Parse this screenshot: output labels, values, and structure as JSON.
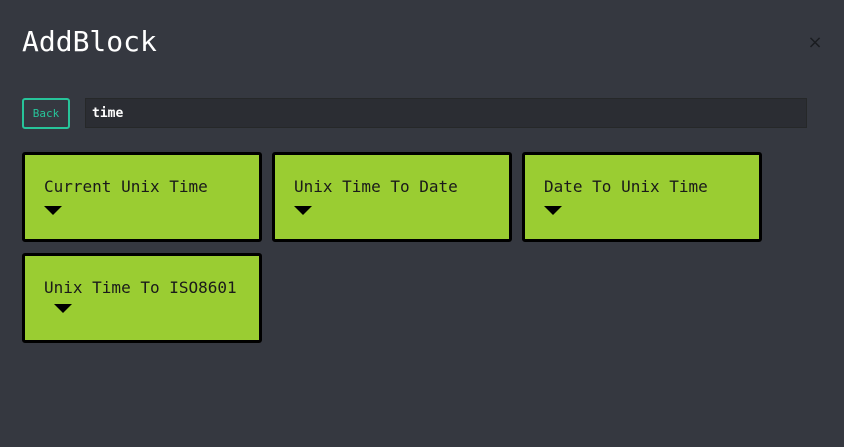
{
  "dialog": {
    "title": "AddBlock",
    "close_label": "×"
  },
  "toolbar": {
    "back_label": "Back",
    "search_value": "time"
  },
  "blocks": [
    {
      "label": "Current Unix Time"
    },
    {
      "label": "Unix Time To Date"
    },
    {
      "label": "Date To Unix Time"
    },
    {
      "label": "Unix Time To ISO8601"
    }
  ],
  "colors": {
    "background": "#353840",
    "accent": "#27c49a",
    "block_fill": "#9acd32",
    "block_border": "#000000"
  }
}
